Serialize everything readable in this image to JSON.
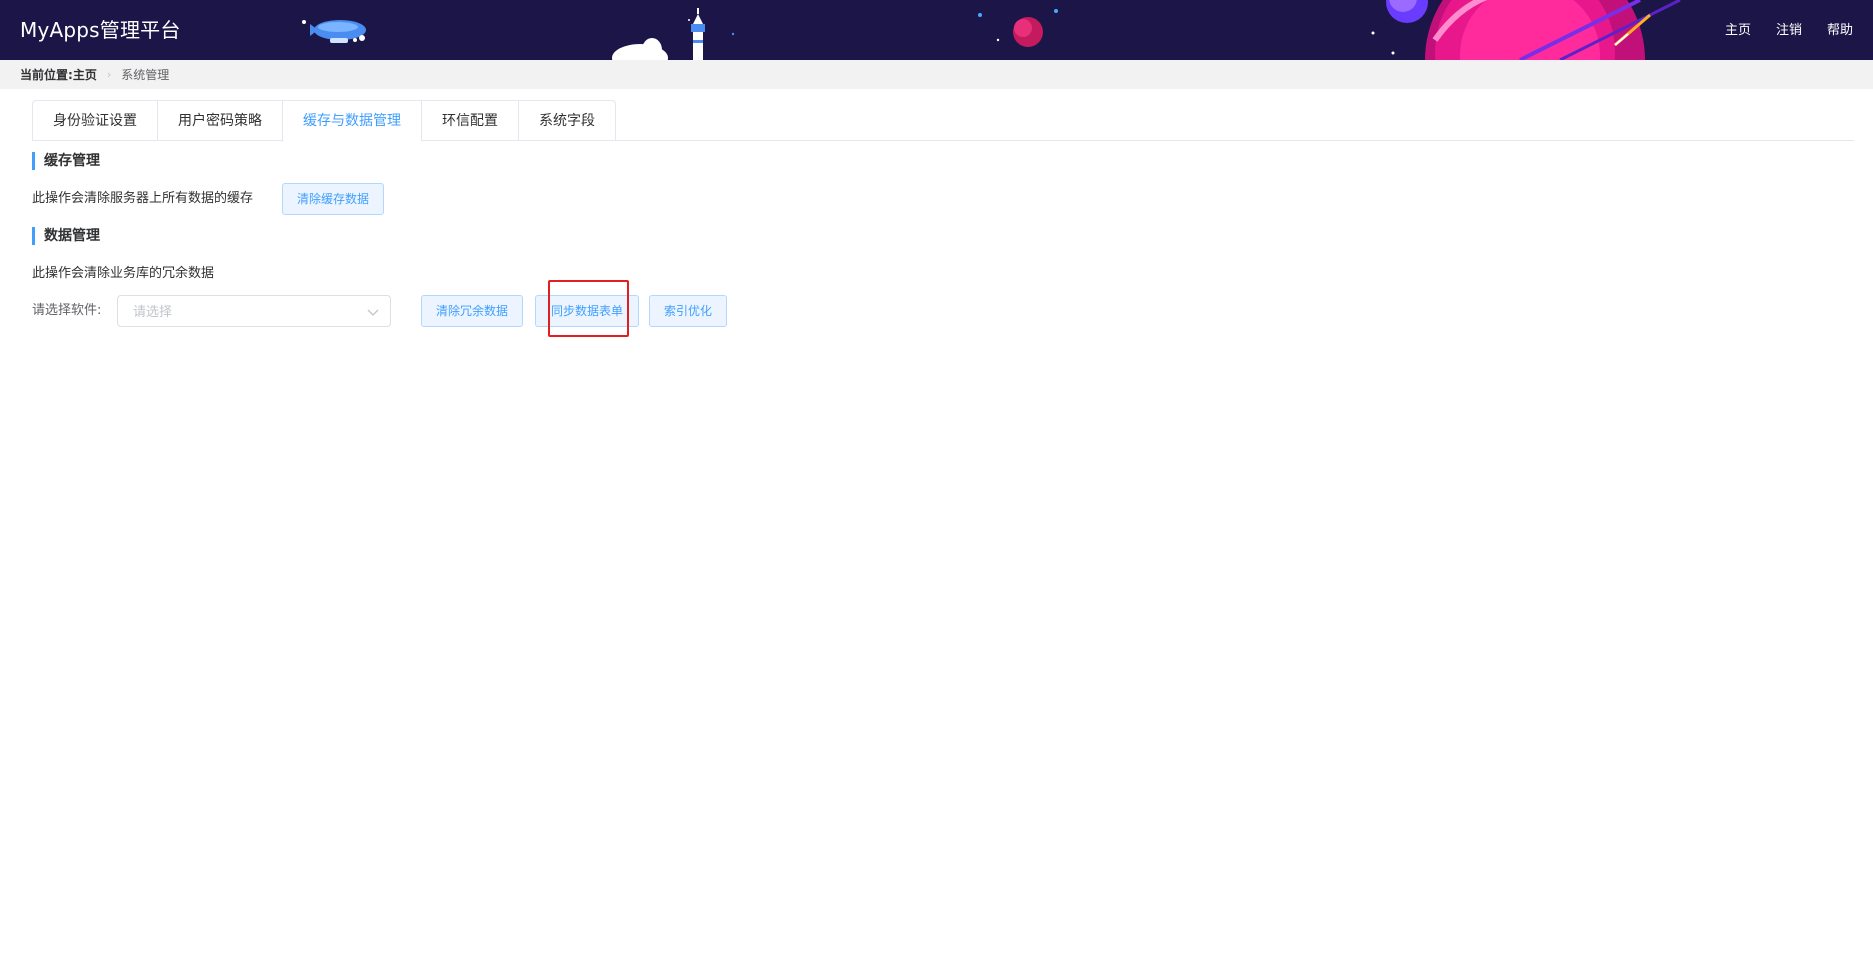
{
  "header": {
    "app_title": "MyApps管理平台",
    "nav": [
      "主页",
      "注销",
      "帮助"
    ],
    "background_color": "#1c1648"
  },
  "breadcrumb": {
    "label": "当前位置:",
    "home": "主页",
    "separator_icon": "chevron-right-icon",
    "current": "系统管理"
  },
  "tabs": {
    "items": [
      "身份验证设置",
      "用户密码策略",
      "缓存与数据管理",
      "环信配置",
      "系统字段"
    ],
    "active_index": 2,
    "active_color": "#409eff"
  },
  "cache": {
    "title": "缓存管理",
    "description": "此操作会清除服务器上所有数据的缓存",
    "clear_button": "清除缓存数据"
  },
  "data": {
    "title": "数据管理",
    "description": "此操作会清除业务库的冗余数据",
    "software_label": "请选择软件:",
    "software_placeholder": "请选择",
    "buttons": {
      "clear_redundant": "清除冗余数据",
      "sync_forms": "同步数据表单",
      "index_optimize": "索引优化"
    },
    "highlight_color": "#e02020"
  }
}
